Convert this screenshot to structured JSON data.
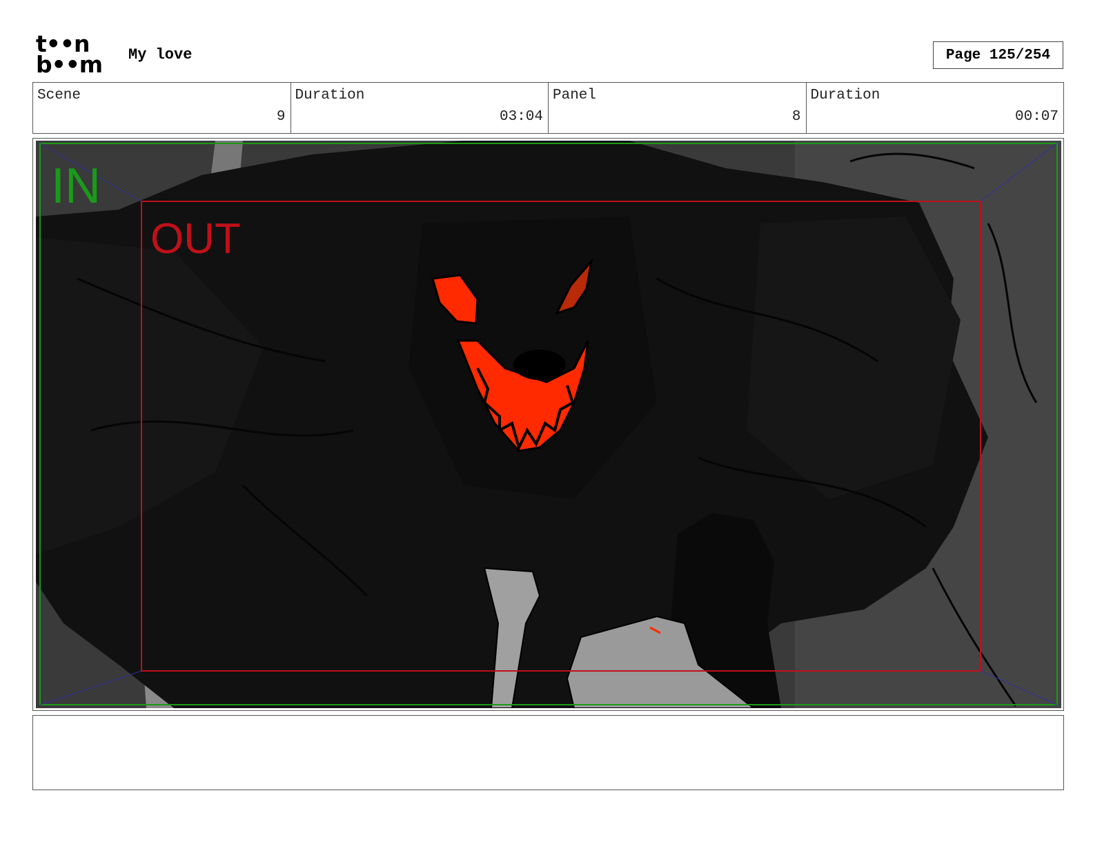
{
  "header": {
    "logo_line1": "t••n",
    "logo_line2": "b••m",
    "project_title": "My love",
    "page_label": "Page 125/254"
  },
  "info": {
    "scene_label": "Scene",
    "scene_value": "9",
    "scene_duration_label": "Duration",
    "scene_duration_value": "03:04",
    "panel_label": "Panel",
    "panel_value": "8",
    "panel_duration_label": "Duration",
    "panel_duration_value": "00:07"
  },
  "panel": {
    "in_label": "IN",
    "out_label": "OUT",
    "in_color": "#1a9a1a",
    "out_color": "#c0101a",
    "accent_red": "#ff2a00"
  },
  "notes": {
    "text": ""
  }
}
